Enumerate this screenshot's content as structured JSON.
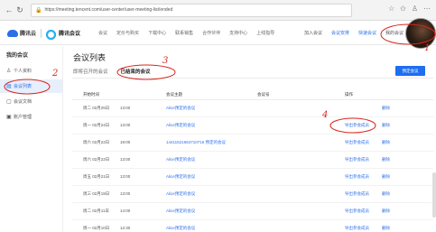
{
  "browser": {
    "back_icon": "back-arrow-icon",
    "refresh_icon": "refresh-icon",
    "url": "https://meeting.tencent.com/user-center/user-meeting-list/ended"
  },
  "header": {
    "logo_text": "腾讯云",
    "product_text": "腾讯会议",
    "nav": [
      "会议",
      "定价与购买",
      "下载中心",
      "联系销售",
      "合作伙伴",
      "支持中心",
      "上线指导"
    ],
    "right_links": [
      "加入会议",
      "会议安排",
      "快速会议",
      "我的会议"
    ]
  },
  "sidebar": {
    "title": "我的会议",
    "items": [
      {
        "label": "个人资料",
        "icon": "person-icon"
      },
      {
        "label": "会议列表",
        "icon": "list-icon"
      },
      {
        "label": "会议文档",
        "icon": "doc-icon"
      },
      {
        "label": "账户管理",
        "icon": "account-icon"
      }
    ]
  },
  "main": {
    "title": "会议列表",
    "tabs": [
      "即将召开的会议",
      "已结束的会议"
    ],
    "schedule_button": "预定会议",
    "columns": [
      "开始时间",
      "会议主题",
      "会议号",
      "操作"
    ],
    "rows": [
      {
        "date": "周二 02月25日",
        "time": "13:00",
        "topic": "Alice预定的会议",
        "id": "",
        "export": "",
        "del": "删除"
      },
      {
        "date": "周一 02月24日",
        "time": "13:00",
        "topic": "Alice预定的会议",
        "id": "",
        "export": "导出参会成员",
        "del": "删除"
      },
      {
        "date": "周六 02月22日",
        "time": "19:00",
        "topic": "14411521654710716 预定的会议",
        "id": "",
        "export": "导出参会成员",
        "del": "删除"
      },
      {
        "date": "周六 02月22日",
        "time": "13:00",
        "topic": "Alice预定的会议",
        "id": "",
        "export": "导出参会成员",
        "del": "删除"
      },
      {
        "date": "周五 02月21日",
        "time": "13:00",
        "topic": "Alice预定的会议",
        "id": "",
        "export": "导出参会成员",
        "del": "删除"
      },
      {
        "date": "周三 02月19日",
        "time": "13:00",
        "topic": "Alice预定的会议",
        "id": "",
        "export": "导出参会成员",
        "del": "删除"
      },
      {
        "date": "周二 02月11日",
        "time": "14:00",
        "topic": "Alice预定的会议",
        "id": "",
        "export": "导出参会成员",
        "del": "删除"
      },
      {
        "date": "周一 02月10日",
        "time": "12:30",
        "topic": "Alice预定的会议",
        "id": "",
        "export": "导出参会成员",
        "del": "删除"
      }
    ]
  },
  "annotations": [
    "1",
    "2",
    "3",
    "4"
  ],
  "colors": {
    "accent": "#1d6ef0",
    "ink": "#d9261c"
  }
}
